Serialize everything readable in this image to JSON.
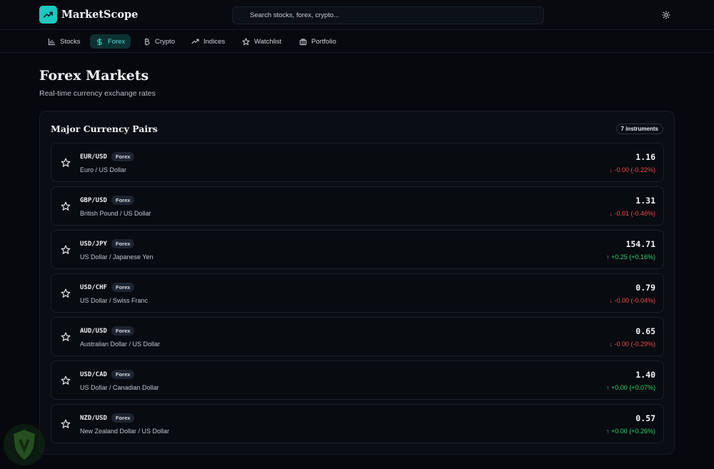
{
  "app": {
    "name": "MarketScope",
    "search_placeholder": "Search stocks, forex, crypto..."
  },
  "colors": {
    "accent": "#1ec7c0",
    "up": "#2fd36b",
    "down": "#ef4b4b",
    "background": "#06080d"
  },
  "nav": {
    "items": [
      {
        "label": "Stocks",
        "icon": "bar-chart-icon",
        "active": false
      },
      {
        "label": "Forex",
        "icon": "dollar-icon",
        "active": true
      },
      {
        "label": "Crypto",
        "icon": "bitcoin-icon",
        "active": false
      },
      {
        "label": "Indices",
        "icon": "trending-up-icon",
        "active": false
      },
      {
        "label": "Watchlist",
        "icon": "star-icon",
        "active": false
      },
      {
        "label": "Portfolio",
        "icon": "briefcase-icon",
        "active": false
      }
    ]
  },
  "page": {
    "title": "Forex Markets",
    "subtitle": "Real-time currency exchange rates"
  },
  "panel": {
    "title": "Major Currency Pairs",
    "count_label": "7 instruments",
    "pairs": [
      {
        "symbol": "EUR/USD",
        "type": "Forex",
        "name": "Euro / US Dollar",
        "price": "1.16",
        "change": "-0.00 (-0.22%)",
        "direction": "down"
      },
      {
        "symbol": "GBP/USD",
        "type": "Forex",
        "name": "British Pound / US Dollar",
        "price": "1.31",
        "change": "-0.01 (-0.46%)",
        "direction": "down"
      },
      {
        "symbol": "USD/JPY",
        "type": "Forex",
        "name": "US Dollar / Japanese Yen",
        "price": "154.71",
        "change": "+0.25 (+0.16%)",
        "direction": "up"
      },
      {
        "symbol": "USD/CHF",
        "type": "Forex",
        "name": "US Dollar / Swiss Franc",
        "price": "0.79",
        "change": "-0.00 (-0.04%)",
        "direction": "down"
      },
      {
        "symbol": "AUD/USD",
        "type": "Forex",
        "name": "Australian Dollar / US Dollar",
        "price": "0.65",
        "change": "-0.00 (-0.29%)",
        "direction": "down"
      },
      {
        "symbol": "USD/CAD",
        "type": "Forex",
        "name": "US Dollar / Canadian Dollar",
        "price": "1.40",
        "change": "+0.00 (+0.07%)",
        "direction": "up"
      },
      {
        "symbol": "NZD/USD",
        "type": "Forex",
        "name": "New Zealand Dollar / US Dollar",
        "price": "0.57",
        "change": "+0.00 (+0.26%)",
        "direction": "up"
      }
    ]
  }
}
